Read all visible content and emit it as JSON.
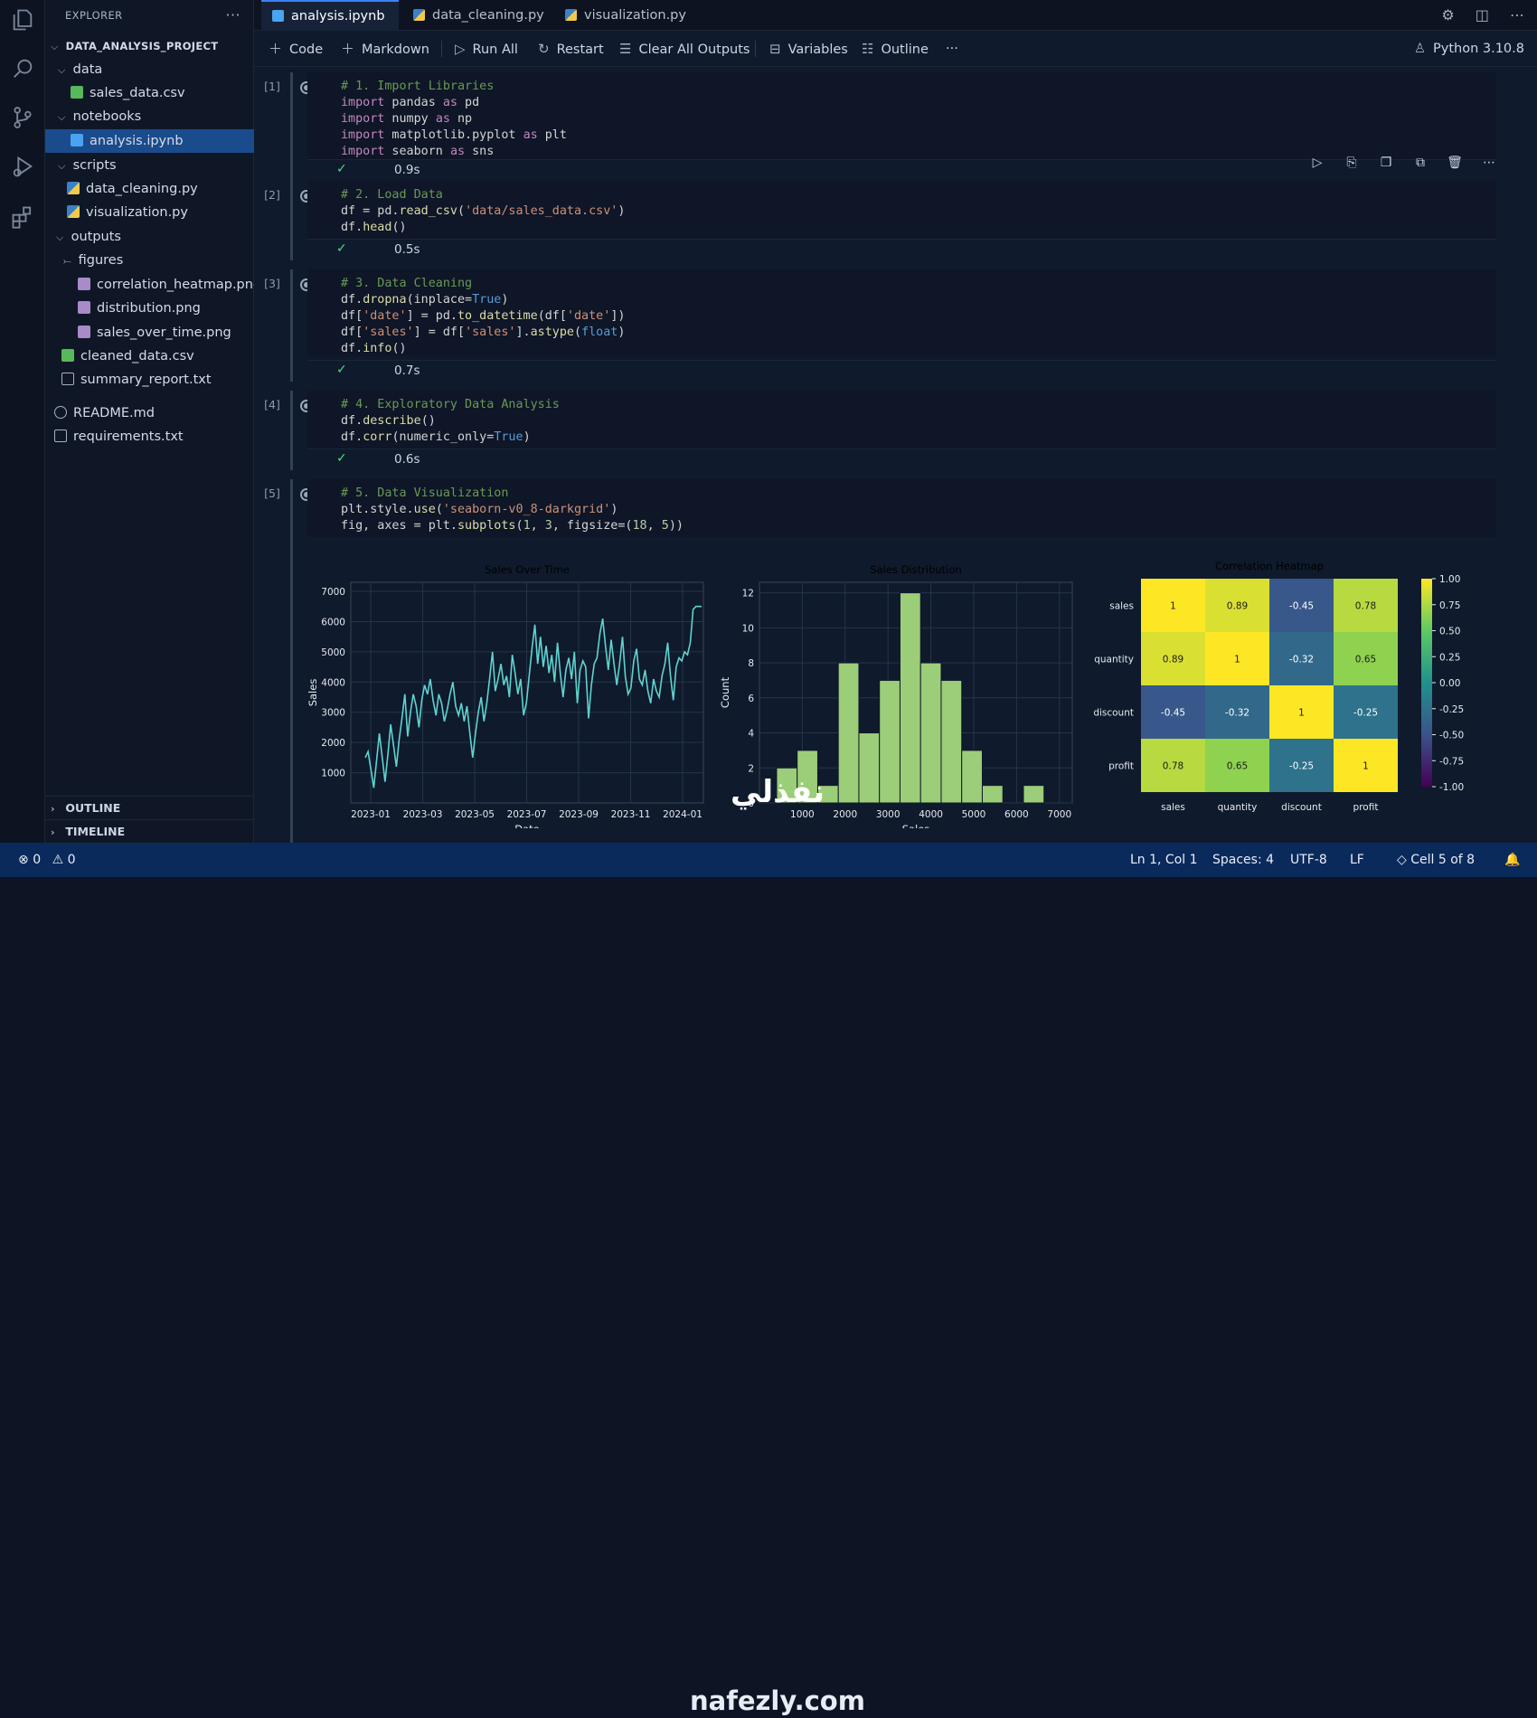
{
  "explorer": {
    "title": "EXPLORER",
    "more": "···",
    "root": "DATA_ANALYSIS_PROJECT",
    "items": [
      {
        "label": "data",
        "kind": "folder"
      },
      {
        "label": "sales_data.csv",
        "kind": "csv"
      },
      {
        "label": "notebooks",
        "kind": "folder"
      },
      {
        "label": "analysis.ipynb",
        "kind": "nb"
      },
      {
        "label": "scripts",
        "kind": "folder"
      },
      {
        "label": "data_cleaning.py",
        "kind": "py"
      },
      {
        "label": "visualization.py",
        "kind": "py"
      },
      {
        "label": "outputs",
        "kind": "folder"
      },
      {
        "label": "figures",
        "kind": "folder"
      },
      {
        "label": "correlation_heatmap.png",
        "kind": "img"
      },
      {
        "label": "distribution.png",
        "kind": "img"
      },
      {
        "label": "sales_over_time.png",
        "kind": "img"
      },
      {
        "label": "cleaned_data.csv",
        "kind": "csv"
      },
      {
        "label": "summary_report.txt",
        "kind": "txt"
      },
      {
        "label": "README.md",
        "kind": "info"
      },
      {
        "label": "requirements.txt",
        "kind": "txt"
      }
    ],
    "outline": "OUTLINE",
    "timeline": "TIMELINE"
  },
  "tabs": [
    {
      "label": "analysis.ipynb",
      "close": "✕"
    },
    {
      "label": "data_cleaning.py"
    },
    {
      "label": "visualization.py"
    }
  ],
  "toolbar": {
    "code": "Code",
    "markdown": "Markdown",
    "run_all": "Run All",
    "restart": "Restart",
    "clear": "Clear All Outputs",
    "variables": "Variables",
    "outline": "Outline",
    "more": "···",
    "kernel": "Python 3.10.8"
  },
  "cells": [
    {
      "n": "[1]",
      "time": "0.9s"
    },
    {
      "n": "[2]",
      "time": "0.5s"
    },
    {
      "n": "[3]",
      "time": "0.7s"
    },
    {
      "n": "[4]",
      "time": "0.6s"
    },
    {
      "n": "[5]",
      "time": ""
    }
  ],
  "code": {
    "c1": [
      "# 1. Import Libraries",
      "import pandas as pd",
      "import numpy as np",
      "import matplotlib.pyplot as plt",
      "import seaborn as sns"
    ],
    "c2": [
      "# 2. Load Data",
      "df = pd.read_csv('data/sales_data.csv')",
      "df.head()"
    ],
    "c3": [
      "# 3. Data Cleaning",
      "df.dropna(inplace=True)",
      "df['date'] = pd.to_datetime(df['date'])",
      "df['sales'] = df['sales'].astype(float)",
      "df.info()"
    ],
    "c4": [
      "# 4. Exploratory Data Analysis",
      "df.describe()",
      "df.corr(numeric_only=True)"
    ],
    "c5": [
      "# 5. Data Visualization",
      "plt.style.use('seaborn-v0_8-darkgrid')",
      "fig, axes = plt.subplots(1, 3, figsize=(18, 5))"
    ]
  },
  "chart_data": [
    {
      "type": "line",
      "title": "Sales Over Time",
      "xlabel": "Date",
      "ylabel": "Sales",
      "x_ticks": [
        "2023-01",
        "2023-03",
        "2023-05",
        "2023-07",
        "2023-09",
        "2023-11",
        "2024-01"
      ],
      "y_ticks": [
        1000,
        2000,
        3000,
        4000,
        5000,
        6000,
        7000
      ],
      "ylim": [
        0,
        7300
      ],
      "color": "#5fd3d0",
      "values": [
        1500,
        1700,
        1100,
        500,
        1400,
        2300,
        1500,
        700,
        1600,
        2600,
        1900,
        1200,
        2100,
        2800,
        3600,
        2200,
        3000,
        3600,
        3200,
        2500,
        3400,
        3900,
        3600,
        4100,
        3400,
        2900,
        3600,
        3300,
        2700,
        3100,
        3600,
        4000,
        3200,
        2900,
        3300,
        2700,
        3200,
        2300,
        1500,
        2300,
        3000,
        3500,
        2700,
        3300,
        4100,
        5000,
        3700,
        4100,
        4600,
        3900,
        4200,
        3500,
        4900,
        4300,
        3600,
        4100,
        2900,
        3300,
        4200,
        5100,
        5900,
        4600,
        5500,
        4500,
        5200,
        4300,
        4900,
        4000,
        5300,
        4300,
        3500,
        4400,
        4800,
        4100,
        5000,
        3300,
        4400,
        4700,
        4500,
        2800,
        3900,
        4600,
        4800,
        5600,
        6100,
        5200,
        4400,
        5400,
        4600,
        3900,
        4600,
        5500,
        4200,
        3600,
        3800,
        4700,
        5100,
        4100,
        3900,
        4400,
        3700,
        3300,
        4100,
        3700,
        3500,
        4200,
        4600,
        5300,
        4200,
        3400,
        4500,
        4800,
        4700,
        5000,
        4900,
        5300,
        6400,
        6500,
        6500,
        6500
      ]
    },
    {
      "type": "bar",
      "title": "Sales Distribution",
      "xlabel": "Sales",
      "ylabel": "Count",
      "x_ticks": [
        1000,
        2000,
        3000,
        4000,
        5000,
        6000,
        7000
      ],
      "y_ticks": [
        0,
        2,
        4,
        6,
        8,
        10,
        12
      ],
      "ylim": [
        0,
        12.6
      ],
      "bin_start": 400,
      "bin_width": 480,
      "values": [
        2,
        3,
        1,
        8,
        4,
        7,
        12,
        8,
        7,
        3,
        1,
        0,
        1
      ],
      "color": "#9ccd78"
    },
    {
      "type": "heatmap",
      "title": "Correlation Heatmap",
      "rows": [
        "sales",
        "quantity",
        "discount",
        "profit"
      ],
      "cols": [
        "sales",
        "quantity",
        "discount",
        "profit"
      ],
      "values": [
        [
          1,
          0.89,
          -0.45,
          0.78
        ],
        [
          0.89,
          1,
          -0.32,
          0.65
        ],
        [
          -0.45,
          -0.32,
          1,
          -0.25
        ],
        [
          0.78,
          0.65,
          -0.25,
          1
        ]
      ],
      "labels": [
        [
          "1",
          "0.89",
          "-0.45",
          "0.78"
        ],
        [
          "0.89",
          "1",
          "-0.32",
          "0.65"
        ],
        [
          "-0.45",
          "-0.32",
          "1",
          "-0.25"
        ],
        [
          "0.78",
          "0.65",
          "-0.25",
          "1"
        ]
      ],
      "colorbar_ticks": [
        "1.00",
        "0.75",
        "0.50",
        "0.25",
        "0.00",
        "-0.25",
        "-0.50",
        "-0.75",
        "-1.00"
      ],
      "colormap": "viridis"
    }
  ],
  "status": {
    "errors": "0",
    "warnings": "0",
    "position": "Ln 1, Col 1",
    "spaces": "Spaces: 4",
    "encoding": "UTF-8",
    "eol": "LF",
    "cell": "Cell 5 of 8"
  },
  "watermark": {
    "arabic": "نفذلي",
    "domain": "nafezly.com"
  }
}
